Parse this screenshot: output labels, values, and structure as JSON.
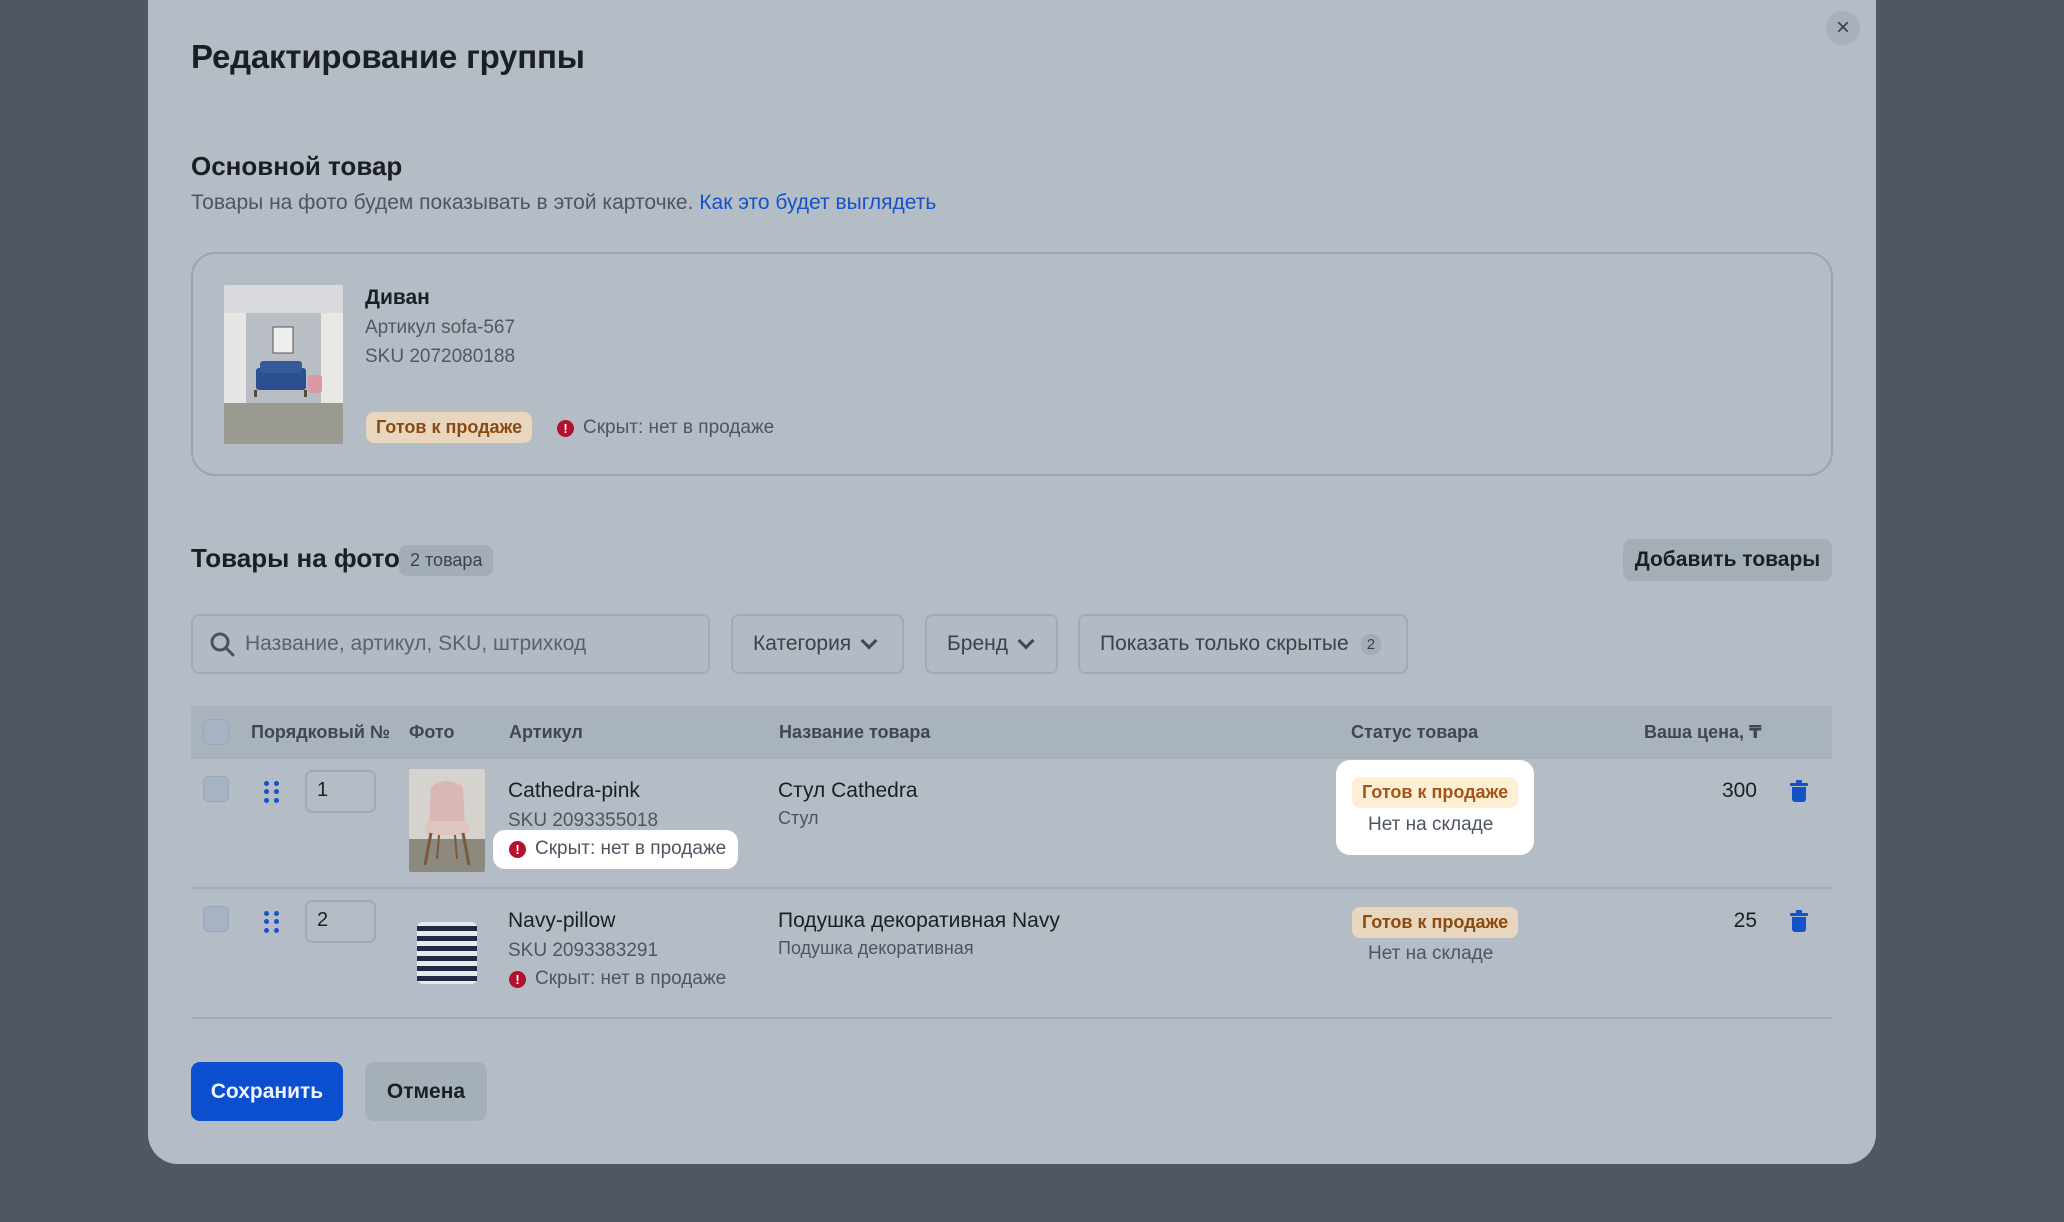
{
  "modal": {
    "title": "Редактирование группы",
    "close_label": "×"
  },
  "main_product": {
    "section_title": "Основной товар",
    "subtitle": "Товары на фото будем показывать в этой карточке.",
    "subtitle_link": "Как это будет выглядеть",
    "name": "Диван",
    "article": "Артикул sofa-567",
    "sku": "SKU 2072080188",
    "status": "Готов к продаже",
    "hidden_note": "Скрыт: нет в продаже"
  },
  "photo_products": {
    "section_title": "Товары на фото",
    "count_badge": "2 товара",
    "add_button": "Добавить товары",
    "search_placeholder": "Название, артикул, SKU, штрихкод",
    "filters": {
      "category": "Категория",
      "brand": "Бренд",
      "show_hidden": "Показать только скрытые",
      "show_hidden_count": "2"
    },
    "columns": {
      "order": "Порядковый №",
      "photo": "Фото",
      "article": "Артикул",
      "name": "Название товара",
      "status": "Статус товара",
      "price": "Ваша цена, ₸"
    },
    "rows": [
      {
        "order": "1",
        "article": "Cathedra-pink",
        "sku": "SKU 2093355018",
        "hidden_note": "Скрыт: нет в продаже",
        "name": "Стул Cathedra",
        "category": "Стул",
        "status": "Готов к продаже",
        "stock": "Нет на складе",
        "price": "300"
      },
      {
        "order": "2",
        "article": "Navy-pillow",
        "sku": "SKU 2093383291",
        "hidden_note": "Скрыт: нет в продаже",
        "name": "Подушка декоративная Navy",
        "category": "Подушка декоративная",
        "status": "Готов к продаже",
        "stock": "Нет на складе",
        "price": "25"
      }
    ]
  },
  "footer": {
    "save": "Сохранить",
    "cancel": "Отмена"
  },
  "colors": {
    "overlay": "#4f5861",
    "modal": "#b4bdc5",
    "primary": "#0b4fcf",
    "link": "#1453c7",
    "danger": "#b3112e",
    "ready_bg": "#e8d6be",
    "ready_text": "#8a4a12"
  }
}
